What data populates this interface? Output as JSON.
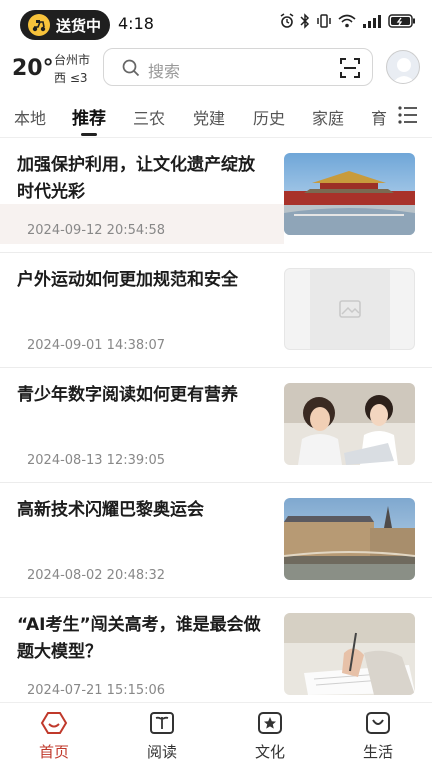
{
  "status_bar": {
    "delivery_label": "送货中",
    "time": "4:18"
  },
  "header": {
    "temperature": "20°",
    "city": "台州市",
    "wind": "西 ≤3",
    "search_placeholder": "搜索"
  },
  "tabs": [
    {
      "label": "本地",
      "active": false
    },
    {
      "label": "推荐",
      "active": true
    },
    {
      "label": "三农",
      "active": false
    },
    {
      "label": "党建",
      "active": false
    },
    {
      "label": "历史",
      "active": false
    },
    {
      "label": "家庭",
      "active": false
    },
    {
      "label": "育",
      "active": false
    }
  ],
  "feed": [
    {
      "title": "加强保护利用，让文化遗产绽放时代光彩",
      "date": "2024-09-12 20:54:58"
    },
    {
      "title": "户外运动如何更加规范和安全",
      "date": "2024-09-01 14:38:07"
    },
    {
      "title": "青少年数字阅读如何更有营养",
      "date": "2024-08-13 12:39:05"
    },
    {
      "title": "高新技术闪耀巴黎奥运会",
      "date": "2024-08-02 20:48:32"
    },
    {
      "title": "“AI考生”闯关高考，谁是最会做题大模型？",
      "date": "2024-07-21 15:15:06"
    }
  ],
  "bottom_nav": [
    {
      "label": "首页",
      "icon": "home-icon",
      "active": true
    },
    {
      "label": "阅读",
      "icon": "book-icon",
      "active": false
    },
    {
      "label": "文化",
      "icon": "star-box-icon",
      "active": false
    },
    {
      "label": "生活",
      "icon": "bag-icon",
      "active": false
    }
  ],
  "colors": {
    "accent": "#c0392b",
    "delivery_badge": "#1f1f1f"
  }
}
